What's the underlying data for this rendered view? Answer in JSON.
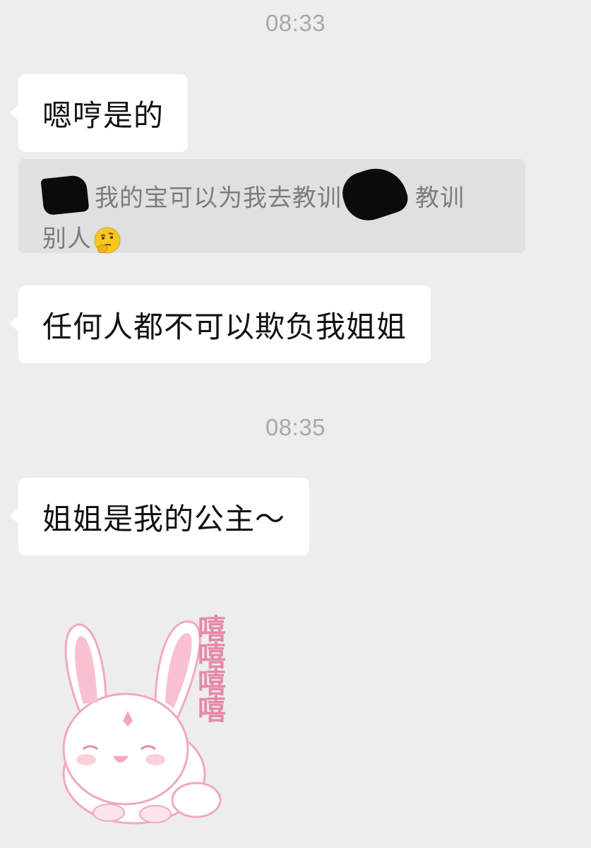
{
  "chat": {
    "timestamps": [
      "08:33",
      "08:35"
    ],
    "messages": [
      {
        "text": "嗯哼是的"
      },
      {
        "text": "任何人都不可以欺负我姐姐"
      },
      {
        "text": "姐姐是我的公主～"
      }
    ],
    "quote": {
      "line1_part1": "我的宝可以为我去教训",
      "line1_part2": "教训",
      "line2": "别人",
      "emoji": "thinking-face-icon"
    },
    "sticker": {
      "caption": "嘻嘻嘻嘻",
      "icon": "bunny-sticker-icon"
    }
  },
  "colors": {
    "background": "#ededed",
    "bubble": "#ffffff",
    "quote_background": "#e0e0e0",
    "timestamp": "#a8a8a8",
    "sticker_pink": "#f4b8c8"
  }
}
